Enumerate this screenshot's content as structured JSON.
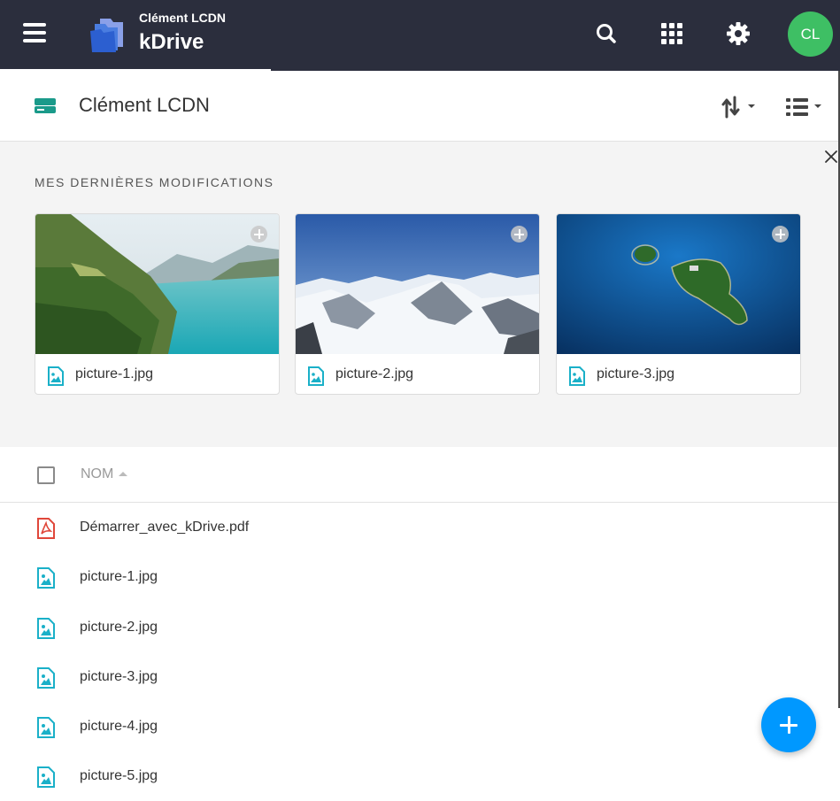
{
  "topbar": {
    "org_name": "Clément LCDN",
    "app_name": "kDrive",
    "icons": [
      "menu-icon",
      "kdrive-logo",
      "search-icon",
      "apps-grid-icon",
      "gear-icon"
    ],
    "avatar_initials": "CL",
    "avatar_color": "#3ebf64",
    "background": "#2b2e3d"
  },
  "header": {
    "title": "Clément LCDN",
    "icons": [
      "drive-icon",
      "sort-icon",
      "list-view-icon"
    ]
  },
  "recent": {
    "title": "MES DERNIÈRES MODIFICATIONS",
    "cards": [
      {
        "name": "picture-1.jpg",
        "thumbnail": "lake-valley"
      },
      {
        "name": "picture-2.jpg",
        "thumbnail": "snowy-mountains"
      },
      {
        "name": "picture-3.jpg",
        "thumbnail": "island-aerial"
      }
    ]
  },
  "list": {
    "column_name": "NOM",
    "items": [
      {
        "name": "Démarrer_avec_kDrive.pdf",
        "type": "pdf"
      },
      {
        "name": "picture-1.jpg",
        "type": "image"
      },
      {
        "name": "picture-2.jpg",
        "type": "image"
      },
      {
        "name": "picture-3.jpg",
        "type": "image"
      },
      {
        "name": "picture-4.jpg",
        "type": "image"
      },
      {
        "name": "picture-5.jpg",
        "type": "image"
      }
    ]
  },
  "colors": {
    "accent": "#0098ff",
    "image_icon": "#1ab0c8",
    "pdf_icon": "#e0473a",
    "drive_icon": "#1a9a8a"
  }
}
